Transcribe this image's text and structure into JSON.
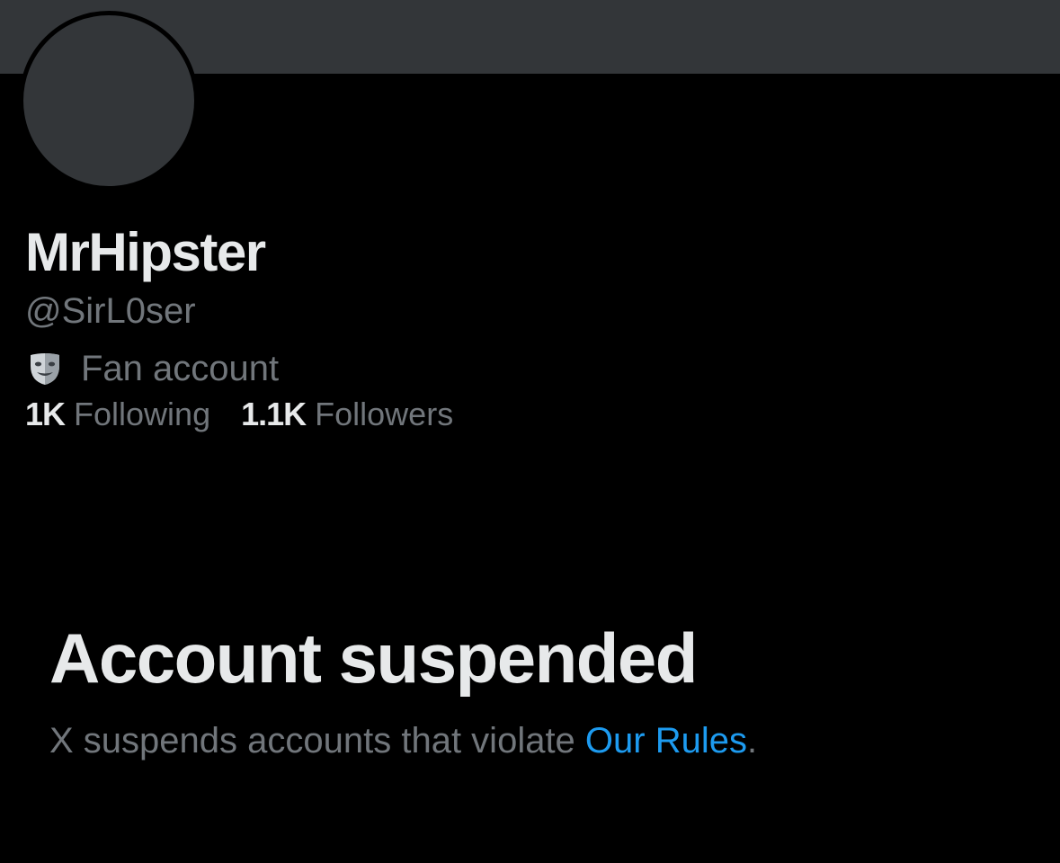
{
  "profile": {
    "display_name": "MrHipster",
    "handle": "@SirL0ser",
    "category_icon": "theater-masks-icon",
    "category": "Fan account",
    "following_count": "1K",
    "following_label": "Following",
    "followers_count": "1.1K",
    "followers_label": "Followers"
  },
  "suspension": {
    "title": "Account suspended",
    "message": "X suspends accounts that violate ",
    "link_text": "Our Rules",
    "trailing": "."
  },
  "colors": {
    "background": "#000000",
    "banner": "#333639",
    "primary_text": "#e7e9ea",
    "secondary_text": "#71767b",
    "link": "#1d9bf0"
  }
}
